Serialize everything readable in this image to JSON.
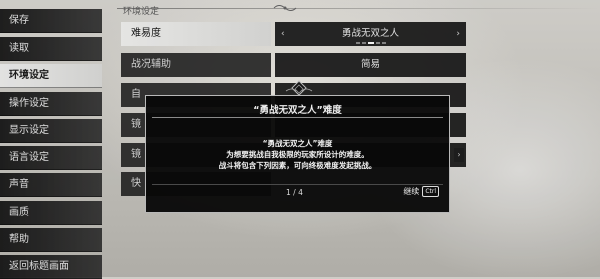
{
  "section_label": "环境设定",
  "sidebar": {
    "items": [
      {
        "label": "保存"
      },
      {
        "label": "读取"
      },
      {
        "label": "环境设定"
      },
      {
        "label": "操作设定"
      },
      {
        "label": "显示设定"
      },
      {
        "label": "语言设定"
      },
      {
        "label": "声音"
      },
      {
        "label": "画质"
      },
      {
        "label": "帮助"
      },
      {
        "label": "返回标题画面"
      }
    ],
    "active_index": 2
  },
  "settings": {
    "difficulty": {
      "label": "难易度",
      "value": "勇战无双之人",
      "left_arrow": "‹",
      "right_arrow": "›"
    },
    "battle_assist": {
      "label": "战况辅助",
      "value": "简易"
    },
    "row3": {
      "label": "自"
    },
    "row4": {
      "label": "镜"
    },
    "row5": {
      "label": "镜"
    },
    "row6": {
      "label": "快"
    }
  },
  "dialog": {
    "title": "“勇战无双之人”难度",
    "lines": [
      "“勇战无双之人”难度",
      "为想要挑战自我极限的玩家所设计的难度。",
      "战斗将包含下列因素，可向终极难度发起挑战。"
    ],
    "page": "1 / 4",
    "continue_label": "继续",
    "continue_key": "Ctrl"
  },
  "colors": {
    "dialog_bg": "#080808",
    "active_bg": "#efefee",
    "sidebar_bg": "#161616"
  }
}
